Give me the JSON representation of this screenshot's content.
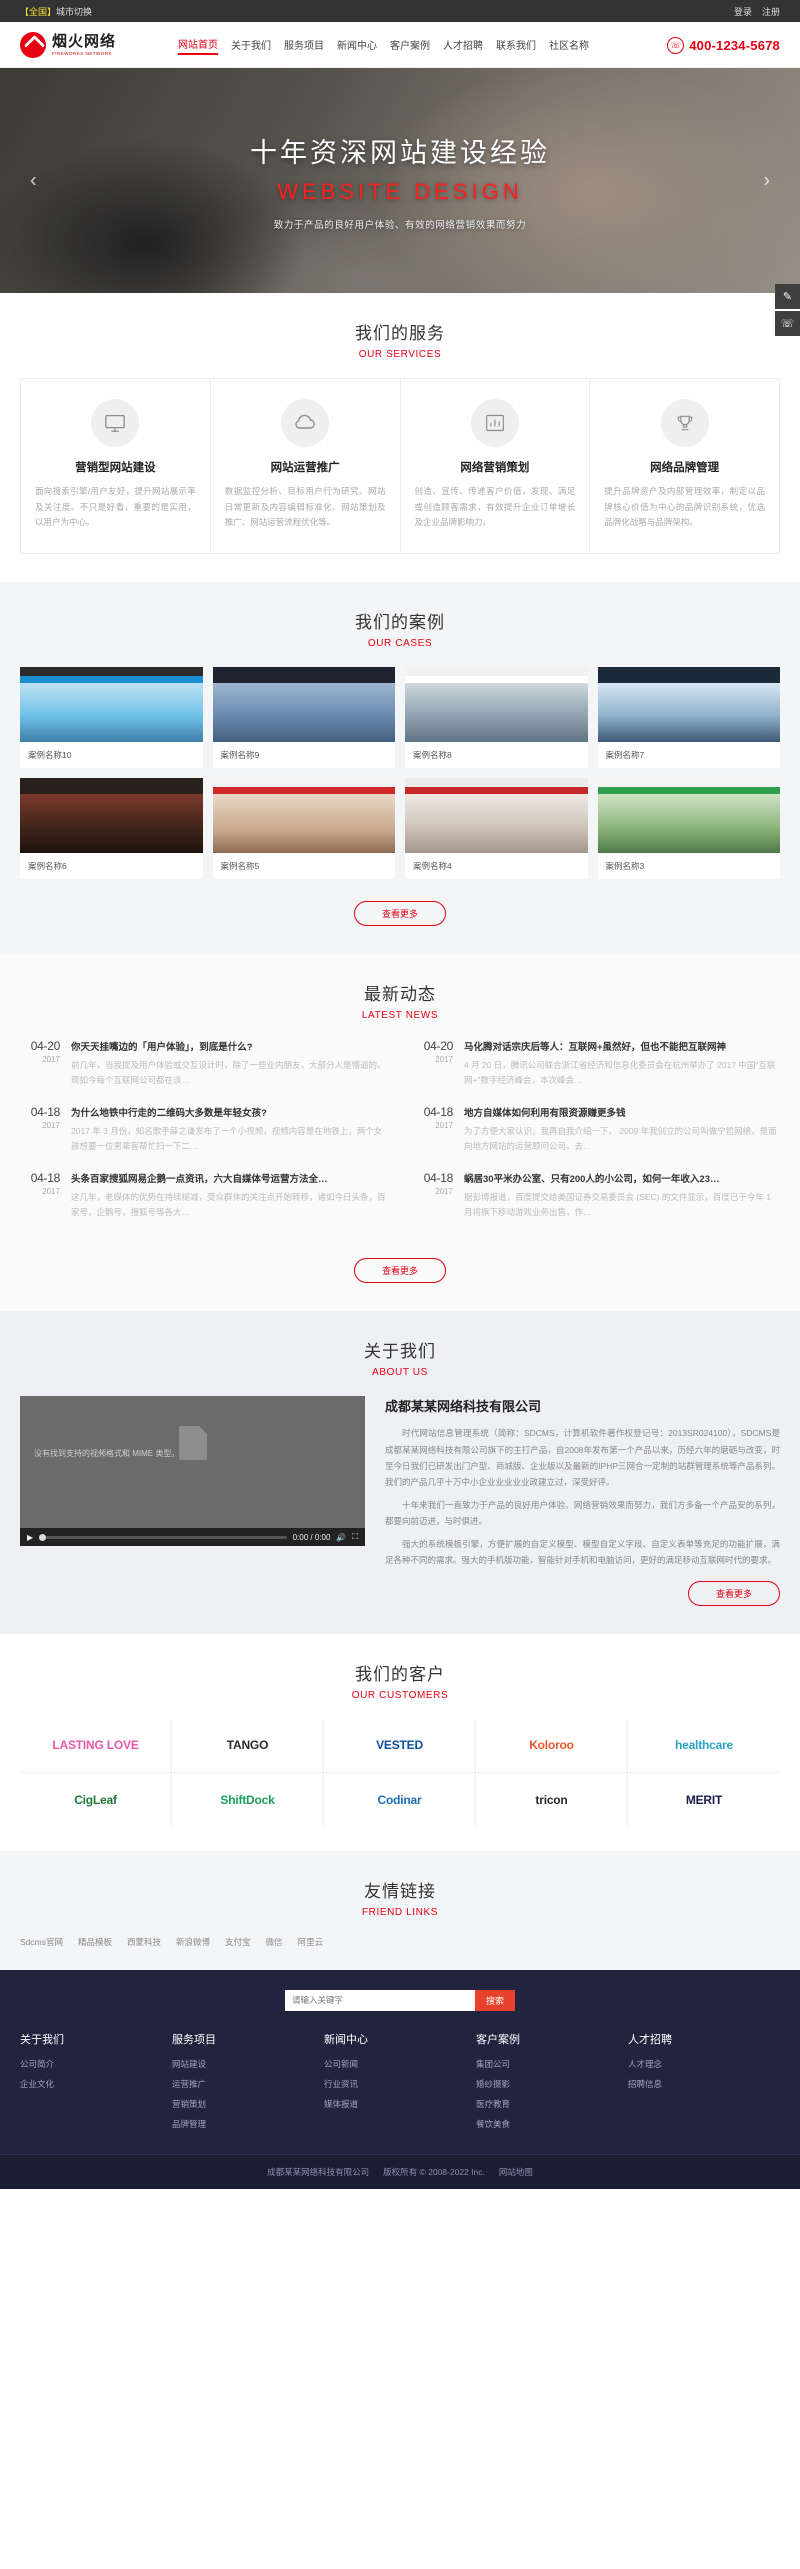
{
  "topbar": {
    "city_prefix": "【全国】",
    "city_label": "城市切换",
    "login": "登录",
    "register": "注册"
  },
  "header": {
    "logo_cn": "烟火网络",
    "logo_en": "FIREWORKS NETWORK",
    "nav": [
      {
        "label": "网站首页",
        "active": true
      },
      {
        "label": "关于我们",
        "active": false
      },
      {
        "label": "服务项目",
        "active": false
      },
      {
        "label": "新闻中心",
        "active": false
      },
      {
        "label": "客户案例",
        "active": false
      },
      {
        "label": "人才招聘",
        "active": false
      },
      {
        "label": "联系我们",
        "active": false
      },
      {
        "label": "社区名称",
        "active": false
      }
    ],
    "phone_icon": "☏",
    "phone": "400-1234-5678"
  },
  "banner": {
    "title": "十年资深网站建设经验",
    "subtitle": "WEBSITE DESIGN",
    "desc": "致力于产品的良好用户体验、有效的网络营销效果而努力",
    "prev": "‹",
    "next": "›"
  },
  "side_tools": [
    {
      "name": "message-icon",
      "glyph": "✎"
    },
    {
      "name": "phone-icon",
      "glyph": "☏"
    }
  ],
  "services": {
    "title_cn": "我们的服务",
    "title_en": "OUR SERVICES",
    "items": [
      {
        "icon": "monitor-icon",
        "title": "营销型网站建设",
        "desc": "面向搜索引擎/用户友好，提升网站展示率及关注度。不只是好看，重要的是实用，以用户为中心。"
      },
      {
        "icon": "cloud-icon",
        "title": "网站运营推广",
        "desc": "数据监控分析、目标用户行为研究、网站日常更新及内容编辑标准化、网站策划及推广、网站运营流程优化等。"
      },
      {
        "icon": "chart-icon",
        "title": "网络营销策划",
        "desc": "创造、宣传、传递客户价值，发现、满足或创造顾客需求，有效提升企业订单增长及企业品牌影响力。"
      },
      {
        "icon": "trophy-icon",
        "title": "网络品牌管理",
        "desc": "提升品牌资产及内部管理效率，制定以品牌核心价值为中心的品牌识别系统，优选品牌化战略与品牌架构。"
      }
    ]
  },
  "cases": {
    "title_cn": "我们的案例",
    "title_en": "OUR CASES",
    "more": "查看更多",
    "items": [
      {
        "caption": "案例名称10",
        "style": "blue-bridge"
      },
      {
        "caption": "案例名称9",
        "style": "dark-bridge"
      },
      {
        "caption": "案例名称8",
        "style": "city-building"
      },
      {
        "caption": "案例名称7",
        "style": "mountain-snow"
      },
      {
        "caption": "案例名称6",
        "style": "food-dark"
      },
      {
        "caption": "案例名称5",
        "style": "red-people"
      },
      {
        "caption": "案例名称4",
        "style": "bath-red"
      },
      {
        "caption": "案例名称3",
        "style": "green-school"
      }
    ]
  },
  "news": {
    "title_cn": "最新动态",
    "title_en": "LATEST NEWS",
    "more": "查看更多",
    "left": [
      {
        "date": "04-20",
        "year": "2017",
        "title": "你天天挂嘴边的「用户体验」，到底是什么?",
        "summary": "前几年，当我提及用户体验或交互设计时，除了一些业内朋友，大部分人是懵逼的。现如今每个互联网公司都在谈…"
      },
      {
        "date": "04-18",
        "year": "2017",
        "title": "为什么地铁中行走的二维码大多数是年轻女孩?",
        "summary": "2017 年 3 月份，知名歌手薛之谦发布了一个小视频，视频内容是在地铁上，两个女孩想要一位男乘客帮忙扫一下二…"
      },
      {
        "date": "04-18",
        "year": "2017",
        "title": "头条百家搜狐网易企鹅一点资讯，六大自媒体号运营方法全…",
        "summary": "这几年，老媒体的优势在持续褪减，受众群体的关注点开始转移，诸如今日头条，百家号，企鹅号，搜狐号等各大…"
      }
    ],
    "right": [
      {
        "date": "04-20",
        "year": "2017",
        "title": "马化腾对话宗庆后等人：互联网+虽然好，但也不能把互联网神",
        "summary": "4 月 20 日，腾讯公司联合浙江省经济和信息化委员会在杭州举办了 2017 中国\"互联网+\"数字经济峰会，本次峰会…"
      },
      {
        "date": "04-18",
        "year": "2017",
        "title": "地方自媒体如何利用有限资源赚更多钱",
        "summary": "为了方便大家认识，我再自我介绍一下。 2009 年我创立的公司叫做宁哲网络，是面向地方网站的运营顾问公司。去…"
      },
      {
        "date": "04-18",
        "year": "2017",
        "title": "蜗居30平米办公室、只有200人的小公司，如何一年收入23…",
        "summary": "据彭博报道，百度提交给美国证券交易委员会 (SEC) 的文件显示，百度已于今年 1 月将旗下移动游戏业务出售，作…"
      }
    ]
  },
  "about": {
    "title_cn": "关于我们",
    "title_en": "ABOUT US",
    "video_note": "没有找到支持的视频格式和 MIME 类型。",
    "video_time": "0:00 / 0:00",
    "company": "成都某某网络科技有限公司",
    "paragraphs": [
      "时代网站信息管理系统（简称：SDCMS，计算机软件著作权登记号：2013SR024100），SDCMS是成都某某网络科技有限公司旗下的主打产品，自2008年发布第一个产品以来，历经六年的磨砺与改变，时至今日我们已研发出门户型、商城版、企业版以及最新的IPHP三网合一定制的站群管理系统等产品系列。我们的产品几乎十万中小企业业业业业政建立过，深受好评。",
      "十年来我们一直致力于产品的良好用户体验、网络营销效果而努力，我们方多备一个产品安的系列，都要向前迈进，与时俱进。",
      "强大的系统模板引擎，方便扩展的自定义模型、模型自定义字段、自定义表单等充足的功能扩展，满足各种不同的需求。强大的手机版功能，智能针对手机和电脑访问，更好的满足移动互联网时代的要求。"
    ],
    "more": "查看更多"
  },
  "customers": {
    "title_cn": "我们的客户",
    "title_en": "OUR CUSTOMERS",
    "logos": [
      "LASTING LOVE",
      "TANGO",
      "VESTED",
      "Koloroo",
      "healthcare",
      "CigLeaf",
      "ShiftDock",
      "Codinar",
      "tricon",
      "MERIT"
    ]
  },
  "friend_links": {
    "title_cn": "友情链接",
    "title_en": "FRIEND LINKS",
    "items": [
      "Sdcms官网",
      "精品模板",
      "西蒙科技",
      "新浪微博",
      "支付宝",
      "微信",
      "阿里云"
    ]
  },
  "footer": {
    "search_placeholder": "请输入关键字",
    "search_button": "搜索",
    "columns": [
      {
        "title": "关于我们",
        "links": [
          "公司简介",
          "企业文化"
        ]
      },
      {
        "title": "服务项目",
        "links": [
          "网站建设",
          "运营推广",
          "营销策划",
          "品牌管理"
        ]
      },
      {
        "title": "新闻中心",
        "links": [
          "公司新闻",
          "行业资讯",
          "媒体报道"
        ]
      },
      {
        "title": "客户案例",
        "links": [
          "集团公司",
          "婚纱摄影",
          "医疗教育",
          "餐饮美食"
        ]
      },
      {
        "title": "人才招聘",
        "links": [
          "人才理念",
          "招聘信息"
        ]
      }
    ],
    "copyright_company": "成都某某网络科技有限公司",
    "copyright_text": "版权所有 © 2008-2022 Inc.",
    "sitemap": "网站地图"
  }
}
